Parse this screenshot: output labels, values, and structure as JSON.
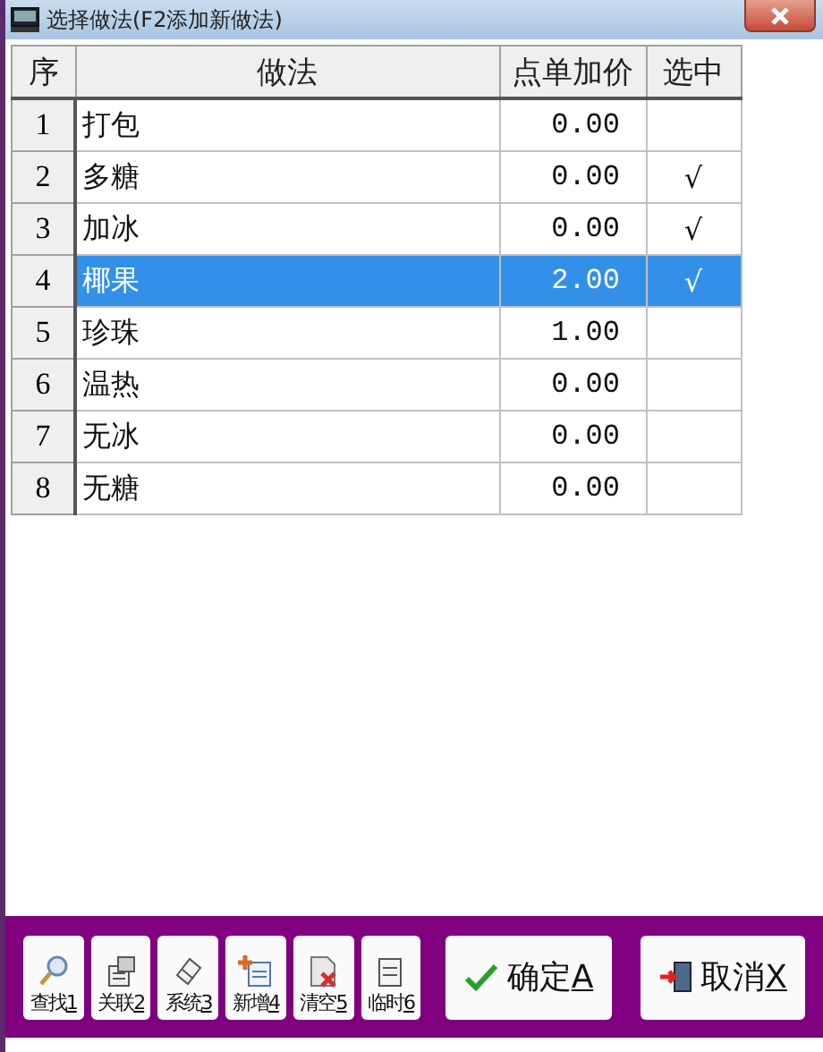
{
  "window": {
    "title": "选择做法(F2添加新做法)"
  },
  "table": {
    "columns": [
      "序",
      "做法",
      "点单加价",
      "选中"
    ],
    "rows": [
      {
        "index": "1",
        "name": "打包",
        "price": "0.00",
        "mark": "",
        "checked": false,
        "selected": false
      },
      {
        "index": "2",
        "name": "多糖",
        "price": "0.00",
        "mark": "√",
        "checked": true,
        "selected": false
      },
      {
        "index": "3",
        "name": "加冰",
        "price": "0.00",
        "mark": "√",
        "checked": true,
        "selected": false
      },
      {
        "index": "4",
        "name": "椰果",
        "price": "2.00",
        "mark": "√",
        "checked": true,
        "selected": true
      },
      {
        "index": "5",
        "name": "珍珠",
        "price": "1.00",
        "mark": "",
        "checked": false,
        "selected": false
      },
      {
        "index": "6",
        "name": "温热",
        "price": "0.00",
        "mark": "",
        "checked": false,
        "selected": false
      },
      {
        "index": "7",
        "name": "无冰",
        "price": "0.00",
        "mark": "",
        "checked": false,
        "selected": false
      },
      {
        "index": "8",
        "name": "无糖",
        "price": "0.00",
        "mark": "",
        "checked": false,
        "selected": false
      }
    ]
  },
  "toolbar": [
    {
      "kind": "search",
      "label": "查找",
      "key": "1"
    },
    {
      "kind": "link",
      "label": "关联",
      "key": "2"
    },
    {
      "kind": "system",
      "label": "系统",
      "key": "3"
    },
    {
      "kind": "add",
      "label": "新增",
      "key": "4"
    },
    {
      "kind": "clear",
      "label": "清空",
      "key": "5"
    },
    {
      "kind": "temp",
      "label": "临时",
      "key": "6"
    }
  ],
  "actions": [
    {
      "kind": "ok",
      "label": "确定",
      "key": "A"
    },
    {
      "kind": "cancel",
      "label": "取消",
      "key": "X"
    }
  ]
}
